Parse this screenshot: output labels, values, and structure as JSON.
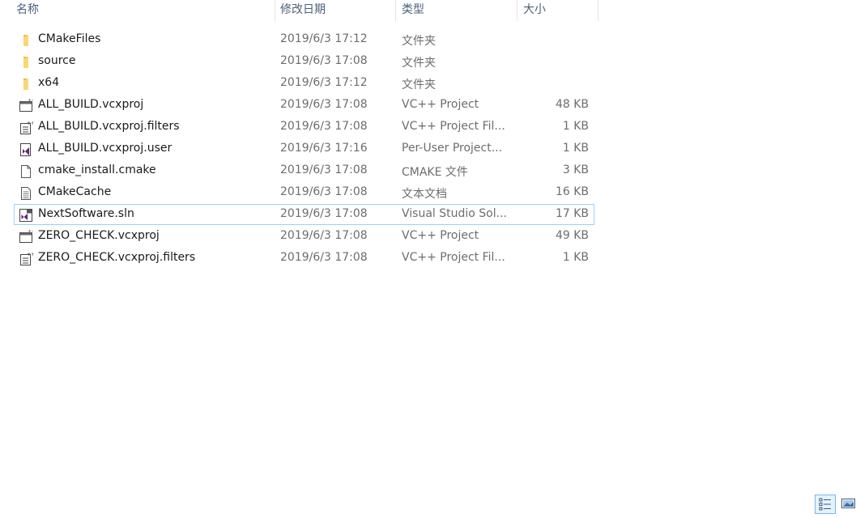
{
  "header": {
    "name": "名称",
    "date": "修改日期",
    "type": "类型",
    "size": "大小"
  },
  "files": [
    {
      "name": "CMakeFiles",
      "date": "2019/6/3 17:12",
      "type": "文件夹",
      "size": "",
      "icon": "folder-icon"
    },
    {
      "name": "source",
      "date": "2019/6/3 17:08",
      "type": "文件夹",
      "size": "",
      "icon": "folder-icon"
    },
    {
      "name": "x64",
      "date": "2019/6/3 17:12",
      "type": "文件夹",
      "size": "",
      "icon": "folder-icon"
    },
    {
      "name": "ALL_BUILD.vcxproj",
      "date": "2019/6/3 17:08",
      "type": "VC++ Project",
      "size": "48 KB",
      "icon": "vcxproj-icon"
    },
    {
      "name": "ALL_BUILD.vcxproj.filters",
      "date": "2019/6/3 17:08",
      "type": "VC++ Project Fil...",
      "size": "1 KB",
      "icon": "vcxproj-filters-icon"
    },
    {
      "name": "ALL_BUILD.vcxproj.user",
      "date": "2019/6/3 17:16",
      "type": "Per-User Project...",
      "size": "1 KB",
      "icon": "visual-studio-icon"
    },
    {
      "name": "cmake_install.cmake",
      "date": "2019/6/3 17:08",
      "type": "CMAKE 文件",
      "size": "3 KB",
      "icon": "blank-file-icon"
    },
    {
      "name": "CMakeCache",
      "date": "2019/6/3 17:08",
      "type": "文本文档",
      "size": "16 KB",
      "icon": "text-file-icon"
    },
    {
      "name": "NextSoftware.sln",
      "date": "2019/6/3 17:08",
      "type": "Visual Studio Sol...",
      "size": "17 KB",
      "icon": "solution-file-icon"
    },
    {
      "name": "ZERO_CHECK.vcxproj",
      "date": "2019/6/3 17:08",
      "type": "VC++ Project",
      "size": "49 KB",
      "icon": "vcxproj-icon"
    },
    {
      "name": "ZERO_CHECK.vcxproj.filters",
      "date": "2019/6/3 17:08",
      "type": "VC++ Project Fil...",
      "size": "1 KB",
      "icon": "vcxproj-filters-icon"
    }
  ],
  "focused_row": "NextSoftware.sln",
  "colors": {
    "focus_border": "#99d1ff",
    "folder": "#f8d775",
    "vs_purple": "#68217a",
    "header_text": "#4c607a",
    "secondary_text": "#6d6d6d"
  },
  "view_switcher": {
    "active": "details-view-icon",
    "inactive": "large-icons-view-icon"
  }
}
